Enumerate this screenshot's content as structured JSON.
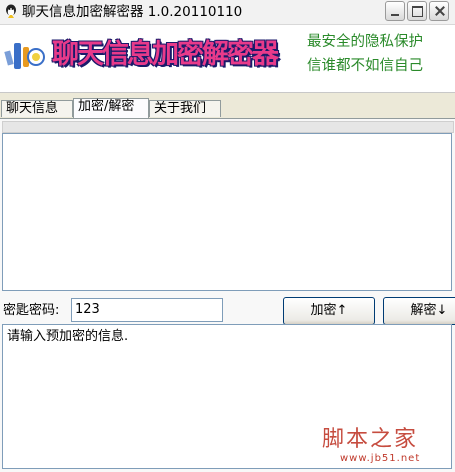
{
  "window": {
    "title": "聊天信息加密解密器 1.0.20110110",
    "controls": [
      "minimize",
      "maximize",
      "close"
    ]
  },
  "banner": {
    "logo_text": "聊天信息加密解密器",
    "slogan_line1": "最安全的隐私保护",
    "slogan_line2": "信谁都不如信自己"
  },
  "tabs": [
    {
      "label": "聊天信息",
      "active": false
    },
    {
      "label": "加密/解密",
      "active": true
    },
    {
      "label": "关于我们",
      "active": false
    }
  ],
  "key": {
    "label": "密匙密码:",
    "value": "123"
  },
  "buttons": {
    "encrypt": "加密↑",
    "decrypt": "解密↓"
  },
  "output_text": "",
  "input_text": "请输入预加密的信息.",
  "watermark": {
    "text": "脚本之家",
    "url": "www.jb51.net"
  },
  "icons": {
    "app": "app-icon",
    "logo": "logo-icon"
  }
}
